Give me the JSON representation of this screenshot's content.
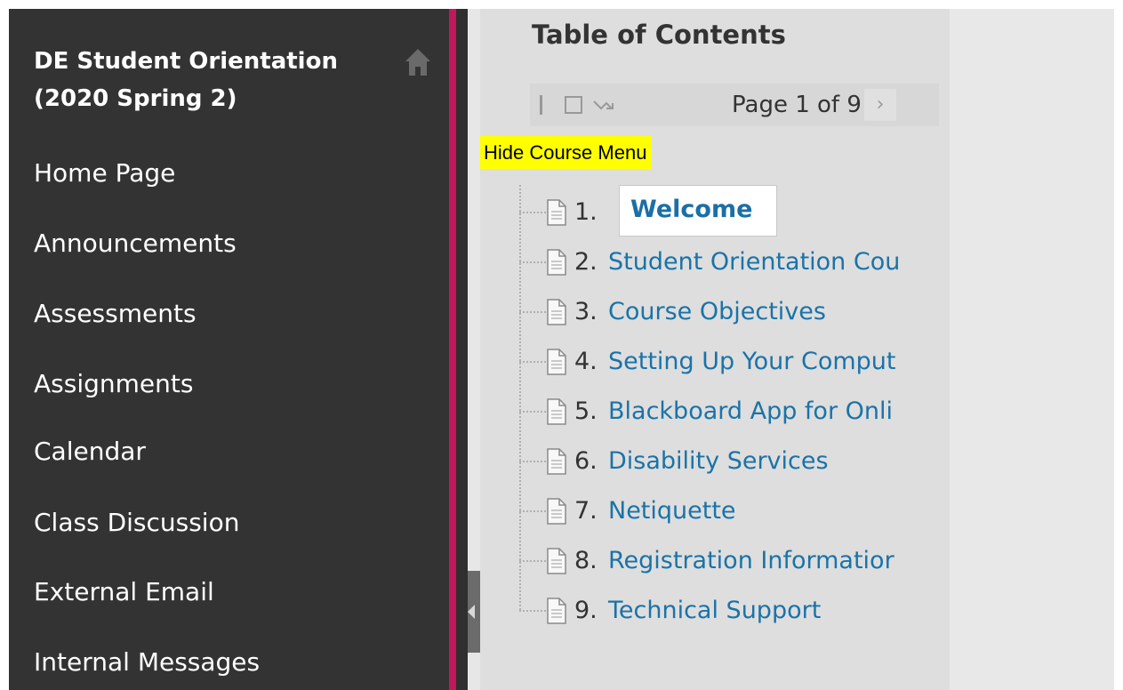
{
  "course": {
    "title_line1": "DE Student Orientation",
    "title_line2": "(2020 Spring 2)"
  },
  "sidebar": {
    "items": [
      {
        "label": "Home Page"
      },
      {
        "label": "Announcements"
      },
      {
        "label": "Assessments"
      },
      {
        "label": "Assignments"
      },
      {
        "label": "Calendar"
      },
      {
        "label": "Class Discussion"
      },
      {
        "label": "External Email"
      },
      {
        "label": "Internal Messages"
      }
    ]
  },
  "toc": {
    "title": "Table of Contents",
    "page_label": "Page 1 of 9",
    "hide_menu_label": "Hide Course Menu",
    "items": [
      {
        "num": "1.",
        "label": "Welcome"
      },
      {
        "num": "2.",
        "label": "Student Orientation Cou"
      },
      {
        "num": "3.",
        "label": "Course Objectives"
      },
      {
        "num": "4.",
        "label": "Setting Up Your Comput"
      },
      {
        "num": "5.",
        "label": "Blackboard App for Onli"
      },
      {
        "num": "6.",
        "label": "Disability Services"
      },
      {
        "num": "7.",
        "label": "Netiquette"
      },
      {
        "num": "8.",
        "label": "Registration Informatior"
      },
      {
        "num": "9.",
        "label": "Technical Support"
      }
    ]
  },
  "icons": {
    "home": "home-icon",
    "doc": "document-icon",
    "next": "chevron-right-icon"
  },
  "colors": {
    "sidebar_bg": "#333333",
    "accent_pink": "#c2185b",
    "link_blue": "#1a73a8",
    "highlight_yellow": "#ffff00"
  }
}
